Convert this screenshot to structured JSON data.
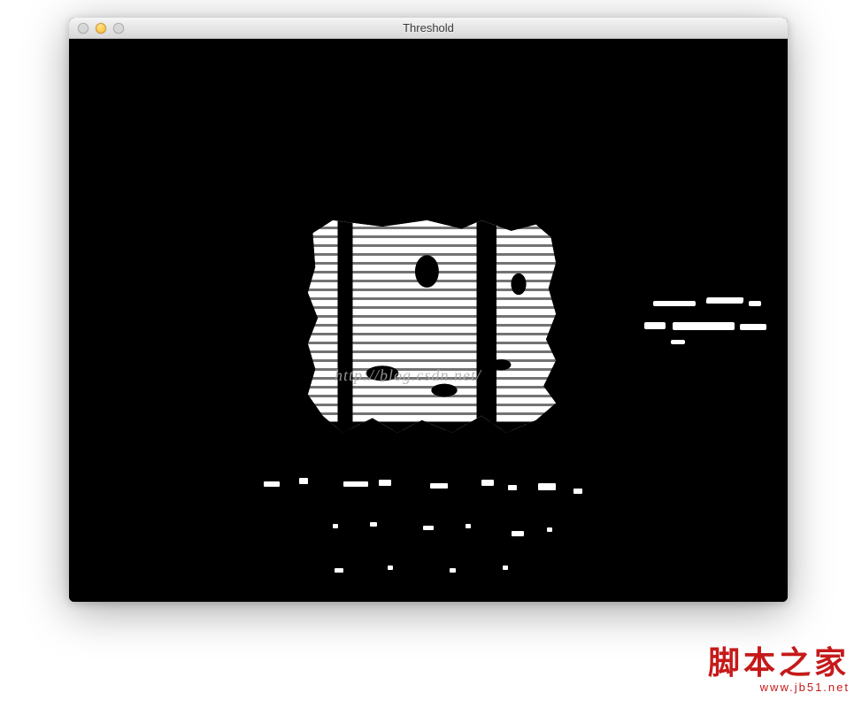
{
  "window": {
    "title": "Threshold"
  },
  "watermarks": {
    "inner_text": "http://blog.csdn.net/",
    "site_cn": "脚本之家",
    "site_en": "www.jb51.net"
  }
}
